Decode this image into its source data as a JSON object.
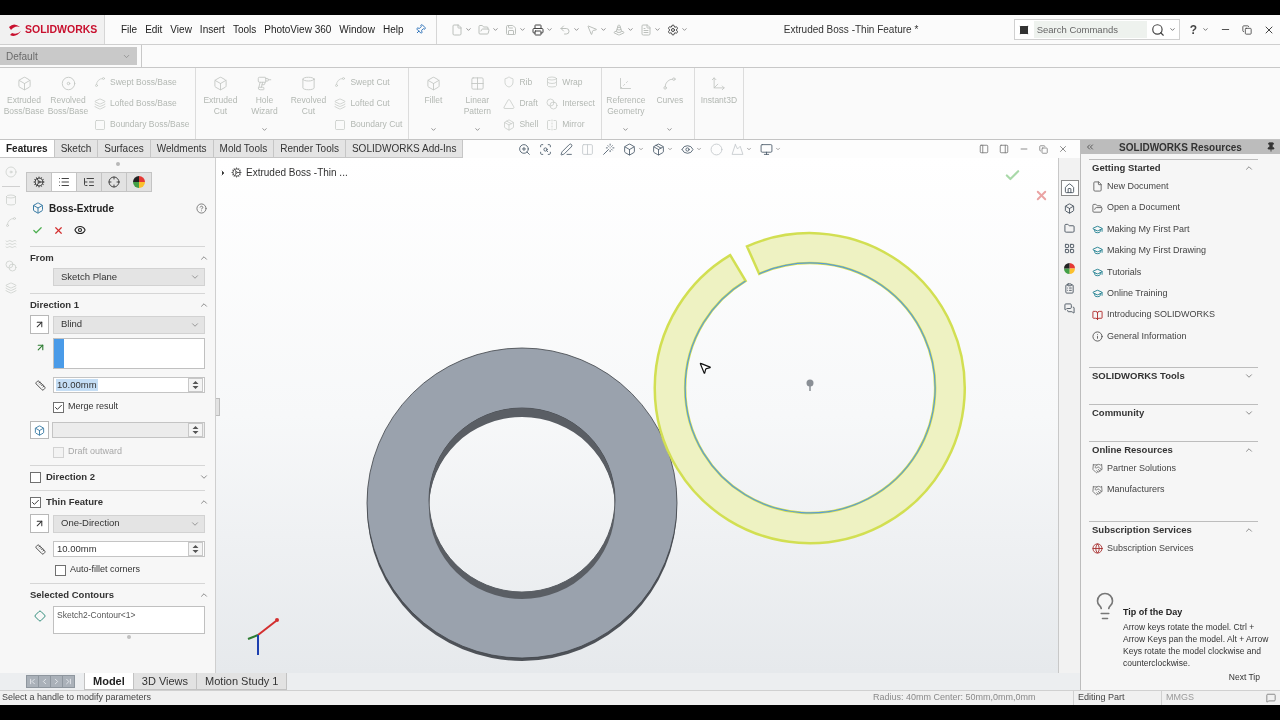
{
  "title_bar": {
    "logo": "SOLIDWORKS",
    "menu": [
      "File",
      "Edit",
      "View",
      "Insert",
      "Tools",
      "PhotoView 360",
      "Window",
      "Help"
    ],
    "quick_access": [
      {
        "disabled": true
      },
      {
        "disabled": true
      },
      {
        "disabled": true
      },
      {
        "disabled": false
      },
      {
        "disabled": true
      },
      {
        "disabled": true
      },
      {
        "disabled": true
      },
      {
        "disabled": true
      },
      {
        "disabled": false
      }
    ],
    "document_title": "Extruded Boss -Thin Feature *",
    "search": {
      "placeholder": "Search Commands"
    },
    "help": "?"
  },
  "configuration": {
    "value": "Default"
  },
  "ribbon": {
    "groups": [
      {
        "tools": [
          {
            "kind": "large",
            "label": "Extruded Boss/Base",
            "disabled": true
          },
          {
            "kind": "large",
            "label": "Revolved Boss/Base",
            "disabled": true
          },
          {
            "kind": "stack",
            "items": [
              {
                "label": "Swept Boss/Base",
                "disabled": true
              },
              {
                "label": "Lofted Boss/Base",
                "disabled": true
              },
              {
                "label": "Boundary Boss/Base",
                "disabled": true
              }
            ]
          }
        ]
      },
      {
        "tools": [
          {
            "kind": "large",
            "label": "Extruded Cut",
            "disabled": true
          },
          {
            "kind": "large",
            "label": "Hole Wizard",
            "disabled": true,
            "dropdown": true
          },
          {
            "kind": "large",
            "label": "Revolved Cut",
            "disabled": true
          },
          {
            "kind": "stack",
            "items": [
              {
                "label": "Swept Cut",
                "disabled": true
              },
              {
                "label": "Lofted Cut",
                "disabled": true
              },
              {
                "label": "Boundary Cut",
                "disabled": true
              }
            ]
          }
        ]
      },
      {
        "tools": [
          {
            "kind": "large",
            "label": "Fillet",
            "disabled": true,
            "dropdown": true
          },
          {
            "kind": "large",
            "label": "Linear Pattern",
            "disabled": true,
            "dropdown": true
          },
          {
            "kind": "stack",
            "items": [
              {
                "label": "Rib",
                "disabled": true
              },
              {
                "label": "Draft",
                "disabled": true
              },
              {
                "label": "Shell",
                "disabled": true
              }
            ]
          },
          {
            "kind": "stack",
            "items": [
              {
                "label": "Wrap",
                "disabled": true
              },
              {
                "label": "Intersect",
                "disabled": true
              },
              {
                "label": "Mirror",
                "disabled": true
              }
            ]
          }
        ]
      },
      {
        "tools": [
          {
            "kind": "large",
            "label": "Reference Geometry",
            "disabled": true,
            "dropdown": true
          },
          {
            "kind": "large",
            "label": "Curves",
            "disabled": true,
            "dropdown": true
          }
        ]
      },
      {
        "tools": [
          {
            "kind": "large",
            "label": "Instant3D",
            "disabled": true
          }
        ]
      }
    ]
  },
  "command_tabs": [
    {
      "label": "Features",
      "selected": true
    },
    {
      "label": "Sketch",
      "selected": false
    },
    {
      "label": "Surfaces",
      "selected": false
    },
    {
      "label": "Weldments",
      "selected": false
    },
    {
      "label": "Mold Tools",
      "selected": false
    },
    {
      "label": "Render Tools",
      "selected": false
    },
    {
      "label": "SOLIDWORKS Add-Ins",
      "selected": false
    }
  ],
  "view_toolbar": [
    {
      "disabled": false
    },
    {
      "disabled": false
    },
    {
      "disabled": false
    },
    {
      "disabled": true
    },
    {
      "disabled": false
    },
    {
      "disabled": false
    },
    {
      "disabled": false
    },
    {
      "disabled": false
    },
    {
      "disabled": true
    },
    {
      "disabled": true
    },
    {
      "disabled": false
    }
  ],
  "feature_flyout": {
    "label": "Extruded Boss -Thin ..."
  },
  "property_manager": {
    "tabs": [
      {
        "selected": false
      },
      {
        "selected": true
      },
      {
        "selected": false
      },
      {
        "selected": false
      },
      {
        "selected": false
      }
    ],
    "title": "Boss-Extrude",
    "from": {
      "title": "From",
      "expanded": true,
      "condition": "Sketch Plane"
    },
    "direction_1": {
      "title": "Direction 1",
      "expanded": true,
      "end_condition": "Blind",
      "depth": {
        "value": "10.00mm",
        "highlighted": true
      },
      "merge_result": {
        "label": "Merge result",
        "checked": true
      },
      "draft": {
        "disabled": true
      },
      "draft_outward": {
        "label": "Draft outward",
        "checked": false,
        "disabled": true
      }
    },
    "direction_2": {
      "title": "Direction 2",
      "checked": false,
      "expanded": false
    },
    "thin_feature": {
      "title": "Thin Feature",
      "checked": true,
      "expanded": true,
      "type": "One-Direction",
      "thickness": "10.00mm",
      "auto_fillet": {
        "label": "Auto-fillet corners",
        "checked": false
      }
    },
    "selected_contours": {
      "title": "Selected Contours",
      "expanded": true,
      "items": [
        "Sketch2-Contour<1>"
      ]
    }
  },
  "task_pane": [
    {
      "selected": true
    },
    {
      "selected": false
    },
    {
      "selected": false
    },
    {
      "selected": false
    },
    {
      "selected": false
    },
    {
      "selected": false
    },
    {
      "selected": false
    }
  ],
  "resources": {
    "title": "SOLIDWORKS Resources",
    "sections": [
      {
        "title": "Getting Started",
        "expanded": true,
        "items": [
          "New Document",
          "Open a Document",
          "Making My First Part",
          "Making My First Drawing",
          "Tutorials",
          "Online Training",
          "Introducing SOLIDWORKS",
          "General Information"
        ]
      },
      {
        "title": "SOLIDWORKS Tools",
        "expanded": false
      },
      {
        "title": "Community",
        "expanded": false
      },
      {
        "title": "Online Resources",
        "expanded": true,
        "items": [
          "Partner Solutions",
          "Manufacturers"
        ]
      },
      {
        "title": "Subscription Services",
        "expanded": true,
        "items": [
          "Subscription Services"
        ]
      }
    ]
  },
  "tip_of_the_day": {
    "title": "Tip of the Day",
    "text": "Arrow keys rotate the model. Ctrl + Arrow Keys pan the model. Alt + Arrow Keys rotate the model clockwise and counterclockwise.",
    "next": "Next Tip"
  },
  "model_tabs": [
    {
      "label": "Model",
      "selected": true
    },
    {
      "label": "3D Views",
      "selected": false
    },
    {
      "label": "Motion Study 1",
      "selected": false
    }
  ],
  "status_bar": {
    "message": "Select a handle to modify parameters",
    "measurement": "Radius: 40mm Center: 50mm,0mm,0mm",
    "mode": "Editing Part",
    "units": "MMGS"
  }
}
